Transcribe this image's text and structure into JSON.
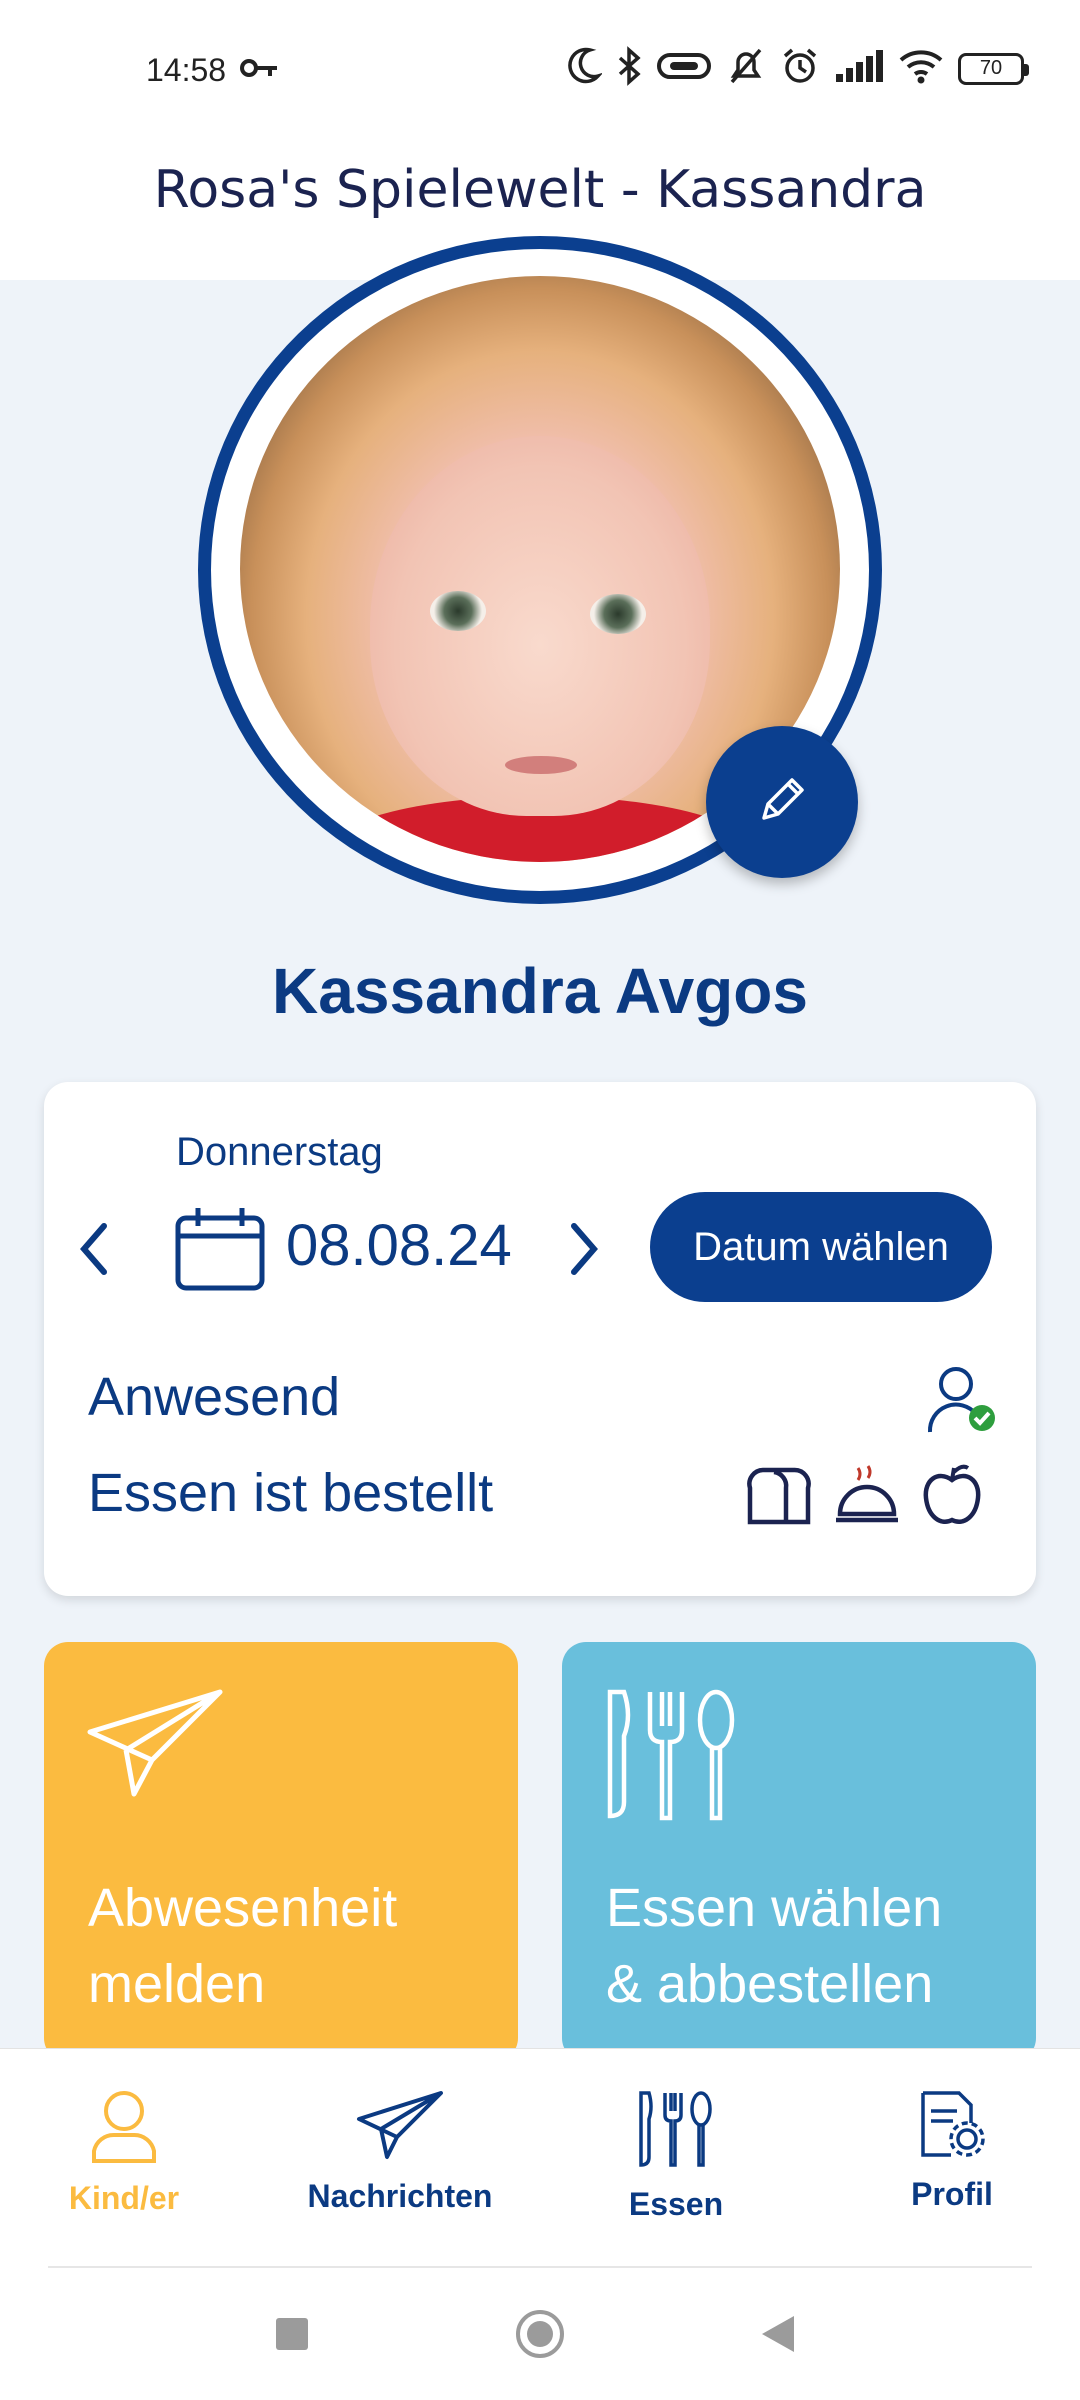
{
  "status_bar": {
    "time": "14:58",
    "battery": "70",
    "icons": [
      "key-icon",
      "moon-icon",
      "bluetooth-icon",
      "vibrate-icon",
      "mute-icon",
      "alarm-icon",
      "signal-icon",
      "wifi-icon",
      "battery-icon"
    ]
  },
  "header": {
    "title": "Rosa's  Spielewelt - Kassandra"
  },
  "profile": {
    "child_name": "Kassandra Avgos",
    "edit_icon": "pencil-icon"
  },
  "day_card": {
    "weekday": "Donnerstag",
    "date": "08.08.24",
    "pick_date_label": "Datum wählen",
    "attendance_label": "Anwesend",
    "meal_status_label": "Essen ist bestellt",
    "meal_icons": [
      "bread-icon",
      "cloche-icon",
      "apple-icon"
    ]
  },
  "tiles": [
    {
      "label_line1": "Abwesenheit",
      "label_line2": "melden",
      "icon": "paper-plane-icon",
      "color": "#fbbb40"
    },
    {
      "label_line1": "Essen wählen",
      "label_line2": "& abbestellen",
      "icon": "cutlery-icon",
      "color": "#69bfdc"
    }
  ],
  "bottom_nav": {
    "items": [
      {
        "label": "Kind/er",
        "icon": "child-icon",
        "active": true
      },
      {
        "label": "Nachrichten",
        "icon": "paper-plane-icon",
        "active": false
      },
      {
        "label": "Essen",
        "icon": "cutlery-icon",
        "active": false
      },
      {
        "label": "Profil",
        "icon": "profile-settings-icon",
        "active": false
      }
    ]
  },
  "colors": {
    "primary": "#0b3f8f",
    "accent_yellow": "#fbbb40",
    "accent_blue": "#69bfdc",
    "background": "#eef3f9"
  }
}
